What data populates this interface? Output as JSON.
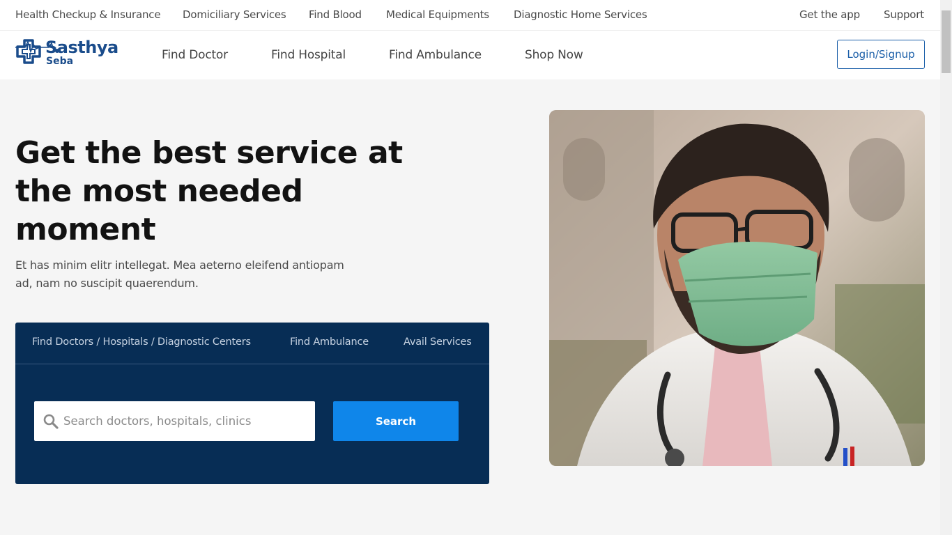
{
  "topbar": {
    "links": [
      "Health Checkup & Insurance",
      "Domiciliary Services",
      "Find Blood",
      "Medical Equipments",
      "Diagnostic Home Services"
    ],
    "right_links": [
      "Get the app",
      "Support"
    ]
  },
  "logo": {
    "title": "Sasthya",
    "subtitle": "Seba"
  },
  "nav": {
    "links": [
      "Find Doctor",
      "Find Hospital",
      "Find Ambulance",
      "Shop Now"
    ],
    "login_label": "Login/Signup"
  },
  "hero": {
    "title": "Get the best service at the most needed moment",
    "description": "Et has minim elitr intellegat. Mea aeterno eleifend antiopam ad, nam no suscipit quaerendum."
  },
  "search_panel": {
    "tabs": [
      "Find Doctors / Hospitals / Diagnostic Centers",
      "Find Ambulance",
      "Avail Services"
    ],
    "input_value": "",
    "placeholder": "Search doctors, hospitals, clinics",
    "button_label": "Search"
  },
  "colors": {
    "brand": "#1a4c8b",
    "panel_bg": "#072d55",
    "search_button": "#0f86ea",
    "page_bg": "#f5f5f5"
  },
  "icons": [
    "logo-cross-icon",
    "heartbeat-icon",
    "search-icon"
  ]
}
